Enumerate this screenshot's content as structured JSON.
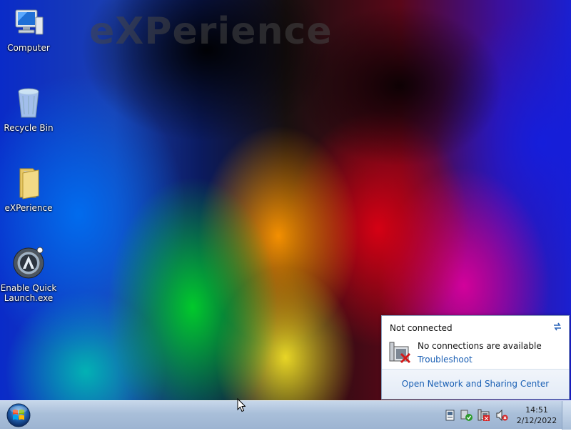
{
  "desktop": {
    "watermark": "eXPerience",
    "icons": [
      {
        "label": "Computer",
        "icon": "computer-icon"
      },
      {
        "label": "Recycle Bin",
        "icon": "recycle-bin-icon"
      },
      {
        "label": "eXPerience",
        "icon": "folder-icon"
      },
      {
        "label_line1": "Enable Quick",
        "label_line2": "Launch.exe",
        "icon": "app-launcher-icon"
      }
    ]
  },
  "network_popup": {
    "status": "Not connected",
    "message": "No connections are available",
    "troubleshoot_link": "Troubleshoot",
    "footer_link": "Open Network and Sharing Center",
    "link_color": "#1a5fb4"
  },
  "taskbar": {
    "start_icon": "windows-start-orb-icon",
    "tray_icons": [
      "action-center-icon",
      "security-check-icon",
      "network-disconnected-icon",
      "volume-muted-icon"
    ],
    "clock": {
      "time": "14:51",
      "date": "2/12/2022"
    }
  }
}
